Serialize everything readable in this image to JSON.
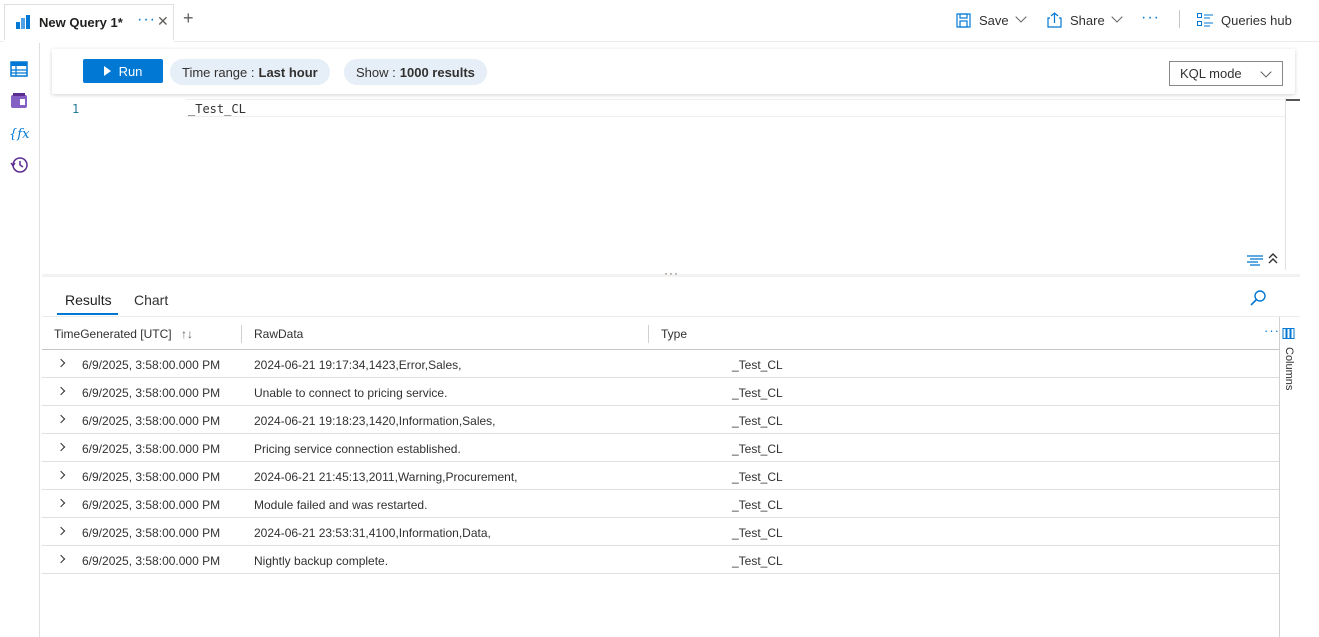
{
  "tab": {
    "title": "New Query 1*",
    "more_glyph": "···",
    "close_glyph": "✕",
    "add_glyph": "+"
  },
  "toolbar": {
    "save_label": "Save",
    "share_label": "Share",
    "more_glyph": "···",
    "queries_hub_label": "Queries hub"
  },
  "rail": {
    "items": [
      "tables-icon",
      "queries-icon",
      "functions-icon",
      "history-icon"
    ]
  },
  "query_bar": {
    "run_label": "Run",
    "time_range_prefix": "Time range :",
    "time_range_value": "Last hour",
    "show_prefix": "Show :",
    "show_value": "1000 results",
    "mode_value": "KQL mode"
  },
  "editor": {
    "line_number": "1",
    "code": "_Test_CL"
  },
  "splitter_glyph": "···",
  "results": {
    "tabs": [
      "Results",
      "Chart"
    ],
    "active_tab": "Results",
    "columns": [
      "TimeGenerated [UTC]",
      "RawData",
      "Type"
    ],
    "sort_glyph": "↑↓",
    "more_glyph": "···",
    "columns_panel_label": "Columns",
    "rows": [
      {
        "time": "6/9/2025, 3:58:00.000 PM",
        "raw": "2024-06-21 19:17:34,1423,Error,Sales,",
        "type": "_Test_CL"
      },
      {
        "time": "6/9/2025, 3:58:00.000 PM",
        "raw": "Unable to connect to pricing service.",
        "type": "_Test_CL"
      },
      {
        "time": "6/9/2025, 3:58:00.000 PM",
        "raw": "2024-06-21 19:18:23,1420,Information,Sales,",
        "type": "_Test_CL"
      },
      {
        "time": "6/9/2025, 3:58:00.000 PM",
        "raw": "Pricing service connection established.",
        "type": "_Test_CL"
      },
      {
        "time": "6/9/2025, 3:58:00.000 PM",
        "raw": "2024-06-21 21:45:13,2011,Warning,Procurement,",
        "type": "_Test_CL"
      },
      {
        "time": "6/9/2025, 3:58:00.000 PM",
        "raw": "Module failed and was restarted.",
        "type": "_Test_CL"
      },
      {
        "time": "6/9/2025, 3:58:00.000 PM",
        "raw": "2024-06-21 23:53:31,4100,Information,Data,",
        "type": "_Test_CL"
      },
      {
        "time": "6/9/2025, 3:58:00.000 PM",
        "raw": "Nightly backup complete.",
        "type": "_Test_CL"
      }
    ]
  },
  "colors": {
    "accent": "#0078d4",
    "pill_bg": "#e6eef7"
  }
}
